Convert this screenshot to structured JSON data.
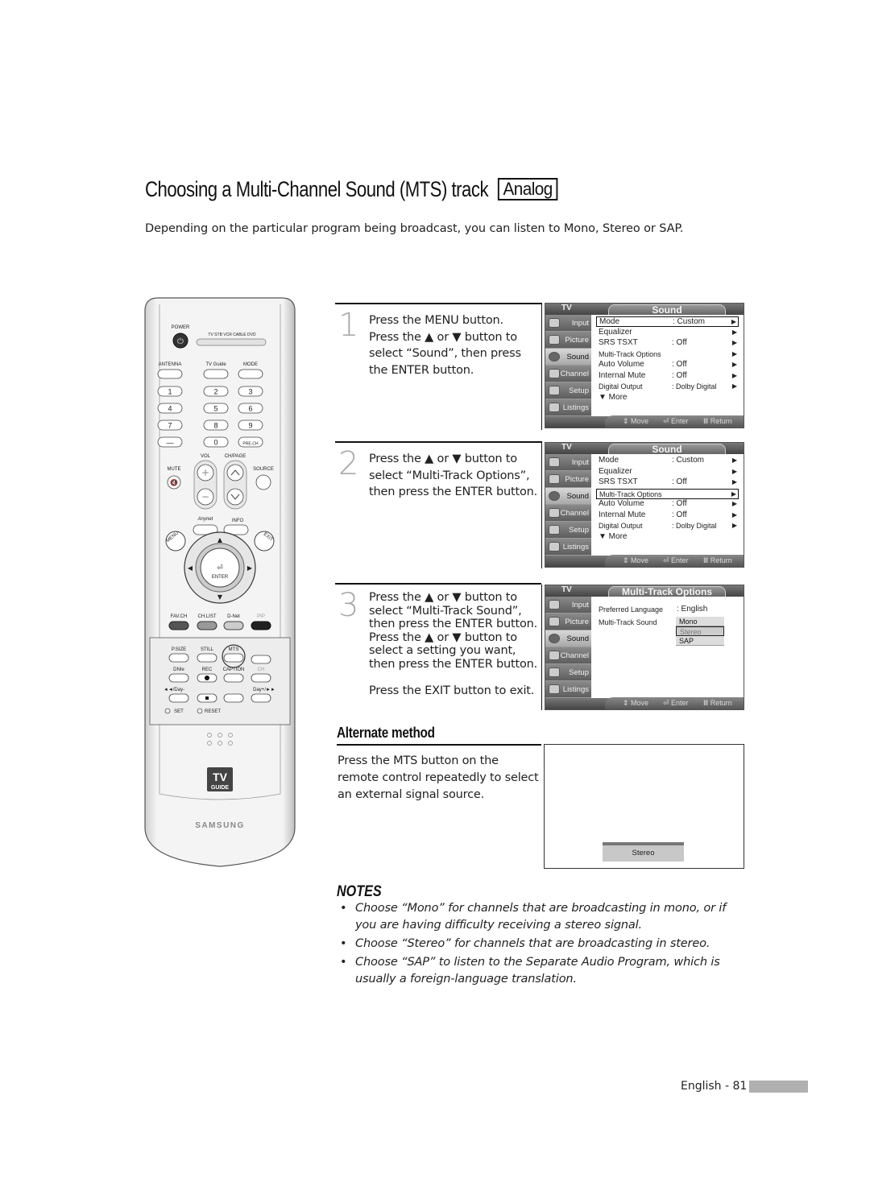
{
  "header": {
    "title": "Choosing a Multi-Channel Sound (MTS) track",
    "badge": "Analog",
    "intro": "Depending on the particular program being broadcast, you can listen to Mono, Stereo or SAP."
  },
  "remote": {
    "labels": {
      "power": "POWER",
      "modes": "TV  STB  VCR  CABLE  DVD",
      "antenna": "ANTENNA",
      "tv_guide": "TV Guide",
      "mode": "MODE",
      "digits": [
        "1",
        "2",
        "3",
        "4",
        "5",
        "6",
        "7",
        "8",
        "9",
        "—",
        "0",
        "PRE-CH"
      ],
      "vol": "VOL",
      "chpage": "CH/PAGE",
      "mute": "MUTE",
      "source": "SOURCE",
      "anynet": "Anynet",
      "info": "INFO",
      "menu": "MENU",
      "exit": "EXIT",
      "enter": "ENTER",
      "favch": "FAV.CH",
      "chlist": "CH.LIST",
      "dnet": "D-Net",
      "pip": "PIP",
      "psize": "P.SIZE",
      "still": "STILL",
      "mts": "MTS",
      "dnie": "DNIe",
      "rec": "REC",
      "caption": "CAPTION",
      "ch": "CH",
      "day_minus": "◄◄/Day-",
      "day_plus": "Day+/►►",
      "set": "SET",
      "reset": "RESET",
      "tvguide_logo_top": "TV",
      "tvguide_logo_bottom": "GUIDE",
      "brand": "SAMSUNG"
    }
  },
  "steps": [
    {
      "number": "1",
      "lines": [
        "Press the MENU button.",
        "Press the ▲ or ▼ button to",
        "select “Sound”, then press",
        "the ENTER button."
      ]
    },
    {
      "number": "2",
      "lines": [
        "Press the ▲ or ▼ button to",
        "select “Multi-Track Options”,",
        "then press the ENTER button."
      ]
    },
    {
      "number": "3",
      "lines": [
        "Press the ▲ or ▼ button to",
        "select “Multi-Track Sound”,",
        "then press the ENTER button.",
        "Press the ▲ or ▼ button to",
        "select a setting you want,",
        "then press the ENTER button."
      ],
      "extra": "Press the EXIT button to exit."
    }
  ],
  "osd": {
    "tv_label": "TV",
    "sidebar": [
      "Input",
      "Picture",
      "Sound",
      "Channel",
      "Setup",
      "Listings"
    ],
    "footer": {
      "move": "⇕ Move",
      "enter": "⏎ Enter",
      "return": "Ⅲ Return"
    },
    "sound_menu": {
      "title": "Sound",
      "rows": [
        {
          "label": "Mode",
          "value": ": Custom"
        },
        {
          "label": "Equalizer",
          "value": ""
        },
        {
          "label": "SRS TSXT",
          "value": ": Off"
        },
        {
          "label": "Multi-Track Options",
          "value": ""
        },
        {
          "label": "Auto Volume",
          "value": ": Off"
        },
        {
          "label": "Internal Mute",
          "value": ": Off"
        },
        {
          "label": "Digital Output",
          "value": ": Dolby Digital"
        }
      ],
      "more": "▼ More",
      "arrow": "▶"
    },
    "mts_menu": {
      "title": "Multi-Track Options",
      "preferred_label": "Preferred Language",
      "preferred_value": ": English",
      "sound_label": "Multi-Track Sound",
      "options": [
        "Mono",
        "Stereo",
        "SAP"
      ],
      "selected": "Stereo"
    }
  },
  "alternate": {
    "title": "Alternate method",
    "lines": [
      "Press the MTS button on the",
      "remote control repeatedly to select",
      "an external signal source."
    ],
    "osd_label": "Stereo"
  },
  "notes": {
    "title": "NOTES",
    "items": [
      "Choose “Mono” for channels that are broadcasting in mono, or if you are having difficulty receiving a stereo signal.",
      "Choose “Stereo” for channels that are broadcasting in stereo.",
      "Choose “SAP” to listen to the Separate Audio Program, which is usually a foreign-language translation."
    ]
  },
  "footer": {
    "page_label": "English - 81"
  }
}
